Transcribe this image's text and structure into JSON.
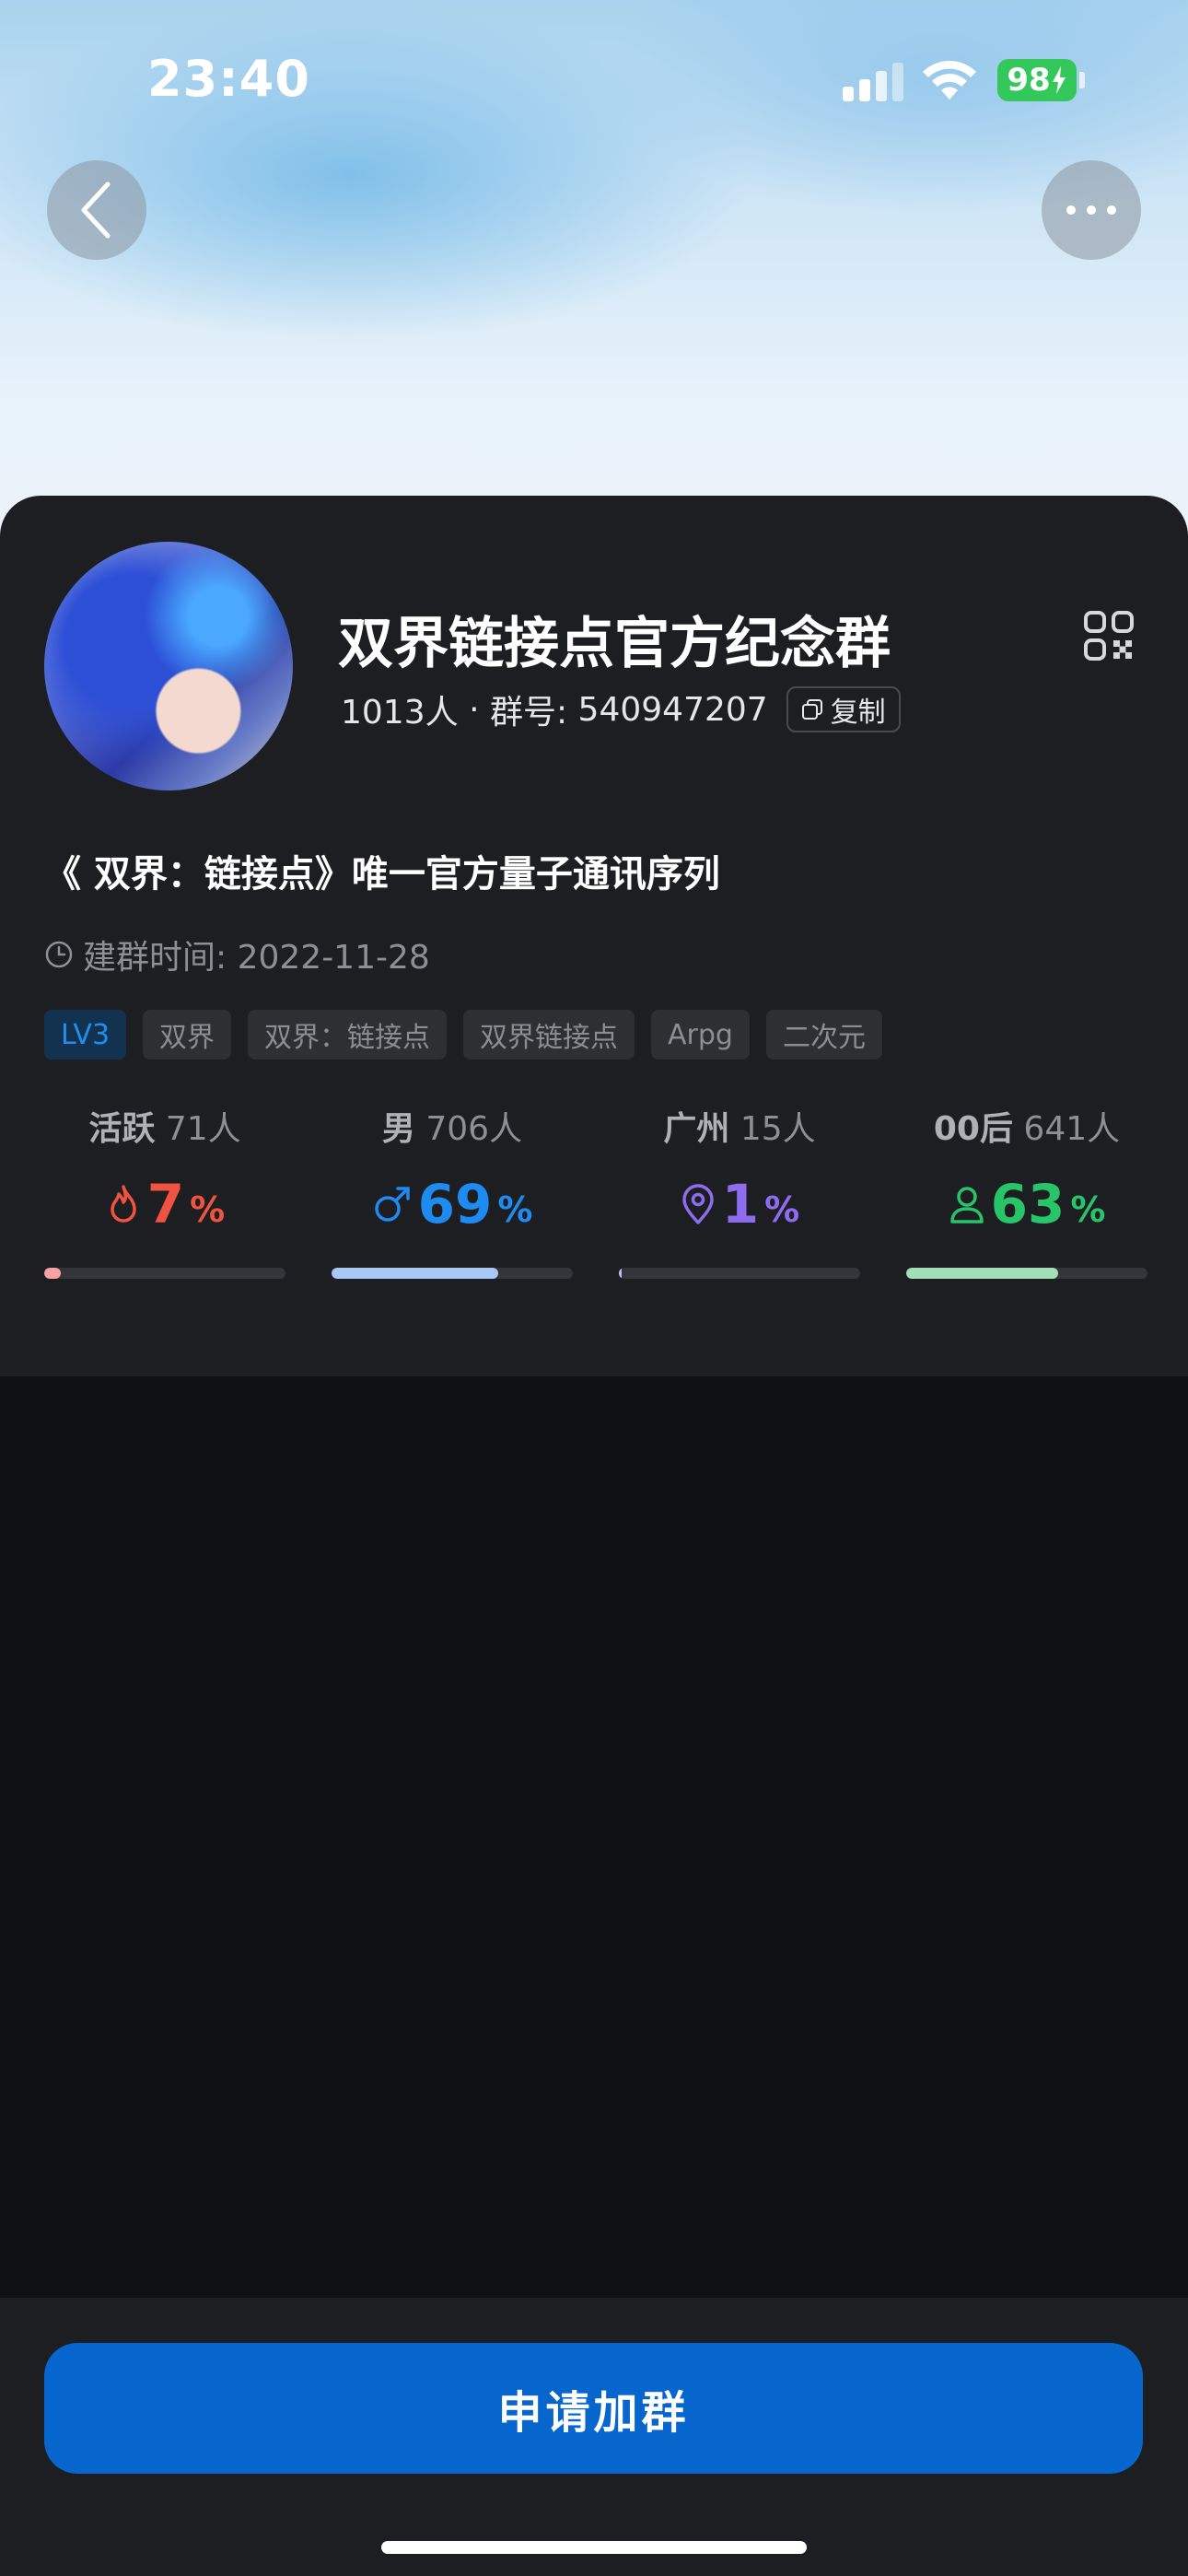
{
  "status_bar": {
    "time": "23:40",
    "battery": "98"
  },
  "group": {
    "name": "双界链接点官方纪念群",
    "member_count": "1013人",
    "separator": " · ",
    "group_number_label": "群号: ",
    "group_number": "540947207",
    "copy_label": "复制",
    "description": "《 双界：链接点》唯一官方量子通讯序列",
    "created_label": "建群时间: ",
    "created_date": "2022-11-28"
  },
  "tags": [
    "LV3",
    "双界",
    "双界：链接点",
    "双界链接点",
    "Arpg",
    "二次元"
  ],
  "stats": [
    {
      "label": "活跃",
      "value": "71人",
      "percent": "7",
      "fraction": 0.07,
      "color": "#f0533f",
      "bar_color": "#f7a3a3",
      "icon": "flame-icon"
    },
    {
      "label": "男",
      "value": "706人",
      "percent": "69",
      "fraction": 0.69,
      "color": "#1e8bf0",
      "bar_color": "#a9c9f4",
      "icon": "male-icon"
    },
    {
      "label": "广州",
      "value": "15人",
      "percent": "1",
      "fraction": 0.01,
      "color": "#8d6cf0",
      "bar_color": "#c9bdf6",
      "icon": "location-pin-icon"
    },
    {
      "label": "00后",
      "value": "641人",
      "percent": "63",
      "fraction": 0.63,
      "color": "#27c46a",
      "bar_color": "#a3dfb6",
      "icon": "person-icon"
    }
  ],
  "percent_sign": "%",
  "footer": {
    "join_label": "申请加群"
  },
  "colors": {
    "accent": "#0766ce",
    "card": "#1d1e21",
    "background": "#101114"
  }
}
